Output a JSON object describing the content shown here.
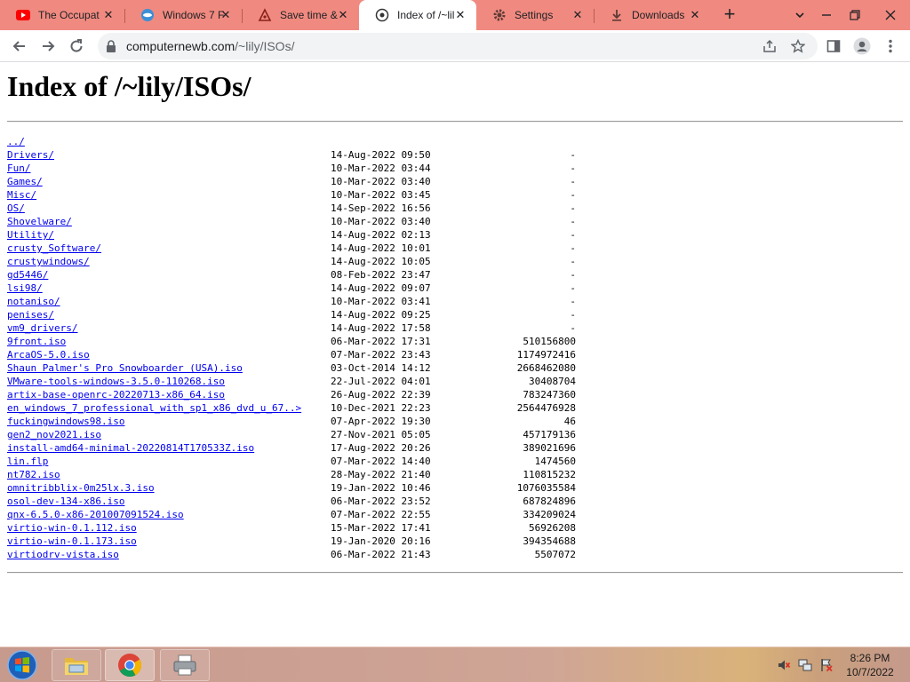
{
  "browser": {
    "tabs": [
      {
        "title": "The Occupat",
        "icon": "youtube-icon",
        "active": false
      },
      {
        "title": "Windows 7 F",
        "icon": "site-icon",
        "active": false
      },
      {
        "title": "Save time &",
        "icon": "site-icon",
        "active": false
      },
      {
        "title": "Index of /~lil",
        "icon": "site-icon",
        "active": true
      },
      {
        "title": "Settings",
        "icon": "gear-icon",
        "active": false
      },
      {
        "title": "Downloads",
        "icon": "download-icon",
        "active": false
      }
    ],
    "address": {
      "host": "computernewb.com",
      "path": "/~lily/ISOs/"
    }
  },
  "page": {
    "title": "Index of /~lily/ISOs/",
    "parent_link": "../",
    "entries": [
      {
        "name": "Drivers/",
        "date": "14-Aug-2022 09:50",
        "size": "-"
      },
      {
        "name": "Fun/",
        "date": "10-Mar-2022 03:44",
        "size": "-"
      },
      {
        "name": "Games/",
        "date": "10-Mar-2022 03:40",
        "size": "-"
      },
      {
        "name": "Misc/",
        "date": "10-Mar-2022 03:45",
        "size": "-"
      },
      {
        "name": "OS/",
        "date": "14-Sep-2022 16:56",
        "size": "-"
      },
      {
        "name": "Shovelware/",
        "date": "10-Mar-2022 03:40",
        "size": "-"
      },
      {
        "name": "Utility/",
        "date": "14-Aug-2022 02:13",
        "size": "-"
      },
      {
        "name": "crusty_Software/",
        "date": "14-Aug-2022 10:01",
        "size": "-"
      },
      {
        "name": "crustywindows/",
        "date": "14-Aug-2022 10:05",
        "size": "-"
      },
      {
        "name": "gd5446/",
        "date": "08-Feb-2022 23:47",
        "size": "-"
      },
      {
        "name": "lsi98/",
        "date": "14-Aug-2022 09:07",
        "size": "-"
      },
      {
        "name": "notaniso/",
        "date": "10-Mar-2022 03:41",
        "size": "-"
      },
      {
        "name": "penises/",
        "date": "14-Aug-2022 09:25",
        "size": "-"
      },
      {
        "name": "vm9_drivers/",
        "date": "14-Aug-2022 17:58",
        "size": "-"
      },
      {
        "name": "9front.iso",
        "date": "06-Mar-2022 17:31",
        "size": "510156800"
      },
      {
        "name": "ArcaOS-5.0.iso",
        "date": "07-Mar-2022 23:43",
        "size": "1174972416"
      },
      {
        "name": "Shaun Palmer's Pro Snowboarder (USA).iso",
        "date": "03-Oct-2014 14:12",
        "size": "2668462080"
      },
      {
        "name": "VMware-tools-windows-3.5.0-110268.iso",
        "date": "22-Jul-2022 04:01",
        "size": "30408704"
      },
      {
        "name": "artix-base-openrc-20220713-x86_64.iso",
        "date": "26-Aug-2022 22:39",
        "size": "783247360"
      },
      {
        "name": "en_windows_7_professional_with_sp1_x86_dvd_u_67..>",
        "date": "10-Dec-2021 22:23",
        "size": "2564476928"
      },
      {
        "name": "fuckingwindows98.iso",
        "date": "07-Apr-2022 19:30",
        "size": "46"
      },
      {
        "name": "gen2_nov2021.iso",
        "date": "27-Nov-2021 05:05",
        "size": "457179136"
      },
      {
        "name": "install-amd64-minimal-20220814T170533Z.iso",
        "date": "17-Aug-2022 20:26",
        "size": "389021696"
      },
      {
        "name": "lin.flp",
        "date": "07-Mar-2022 14:40",
        "size": "1474560"
      },
      {
        "name": "nt782.iso",
        "date": "28-May-2022 21:40",
        "size": "110815232"
      },
      {
        "name": "omnitribblix-0m25lx.3.iso",
        "date": "19-Jan-2022 10:46",
        "size": "1076035584"
      },
      {
        "name": "osol-dev-134-x86.iso",
        "date": "06-Mar-2022 23:52",
        "size": "687824896"
      },
      {
        "name": "qnx-6.5.0-x86-201007091524.iso",
        "date": "07-Mar-2022 22:55",
        "size": "334209024"
      },
      {
        "name": "virtio-win-0.1.112.iso",
        "date": "15-Mar-2022 17:41",
        "size": "56926208"
      },
      {
        "name": "virtio-win-0.1.173.iso",
        "date": "19-Jan-2020 20:16",
        "size": "394354688"
      },
      {
        "name": "virtiodrv-vista.iso",
        "date": "06-Mar-2022 21:43",
        "size": "5507072"
      }
    ]
  },
  "taskbar": {
    "apps": [
      "file-explorer-icon",
      "chrome-icon",
      "printer-icon"
    ],
    "clock": {
      "time": "8:26 PM",
      "date": "10/7/2022"
    }
  },
  "colors": {
    "tabstrip": "#f08a80",
    "link": "#0000ee"
  }
}
